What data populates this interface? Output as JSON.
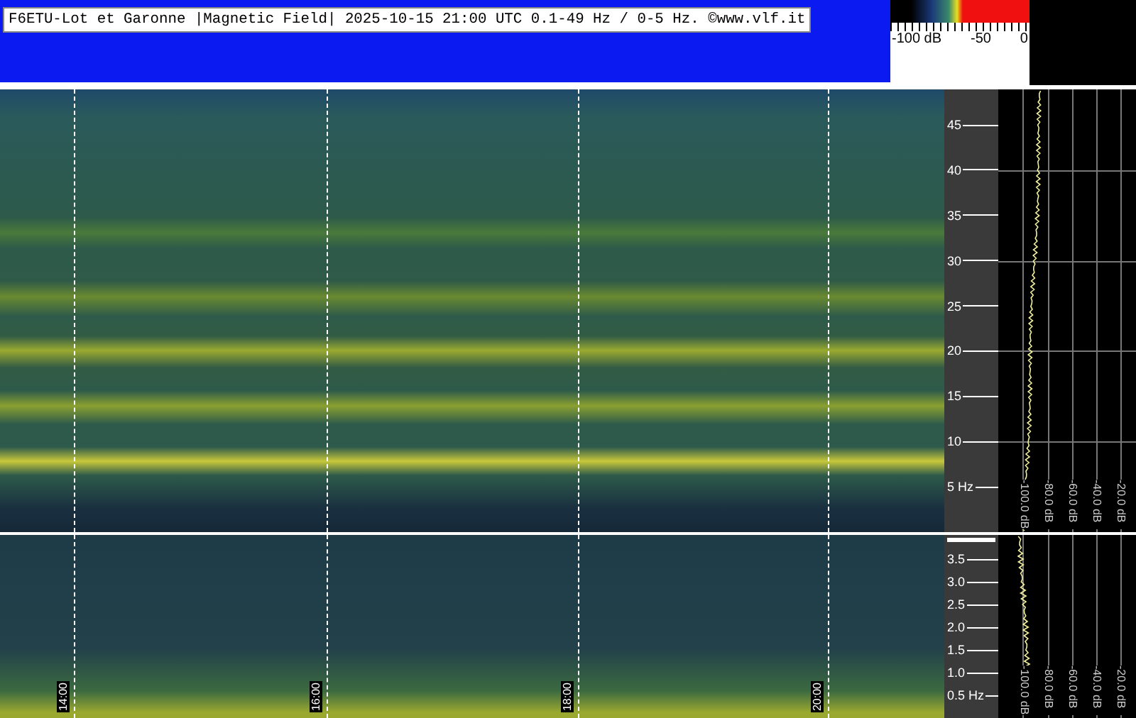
{
  "header": {
    "title": "F6ETU-Lot et Garonne |Magnetic Field| 2025-10-15 21:00 UTC 0.1-49 Hz / 0-5 Hz. ©www.vlf.it"
  },
  "color_scale": {
    "labels": [
      "-100 dB",
      "-50",
      "0"
    ]
  },
  "upper_panel": {
    "frequency_labels": [
      "45",
      "40",
      "35",
      "30",
      "25",
      "20",
      "15",
      "10",
      "5 Hz"
    ],
    "db_labels": [
      "-100.0 dB",
      "-80.0 dB",
      "-60.0 dB",
      "-40.0 dB",
      "-20.0 dB"
    ]
  },
  "lower_panel": {
    "frequency_labels": [
      "3.5",
      "3.0",
      "2.5",
      "2.0",
      "1.5",
      "1.0",
      "0.5 Hz"
    ],
    "db_labels": [
      "-100.0 dB",
      "-80.0 dB",
      "-60.0 dB",
      "-40.0 dB",
      "-20.0 dB"
    ],
    "time_labels": [
      "14:00",
      "16:00",
      "18:00",
      "20:00"
    ]
  }
}
